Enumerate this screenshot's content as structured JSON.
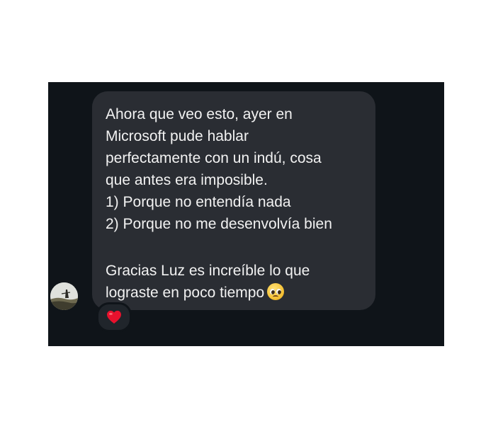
{
  "message": {
    "lines": [
      "Ahora que veo esto, ayer en",
      "Microsoft pude hablar",
      "perfectamente con un indú, cosa",
      "que antes era imposible.",
      "1) Porque no entendía nada",
      "2) Porque no me desenvolvía bien",
      "Gracias Luz es increíble lo que",
      "lograste en poco tiempo"
    ],
    "emoji": "pleading-face-emoji"
  },
  "reaction": {
    "icon": "red-heart-icon",
    "color": "#e8112d"
  },
  "avatar": {
    "icon": "user-avatar"
  },
  "colors": {
    "panel_background": "#0f1419",
    "bubble_background": "#2a2d33",
    "text": "#f2f2f2"
  }
}
